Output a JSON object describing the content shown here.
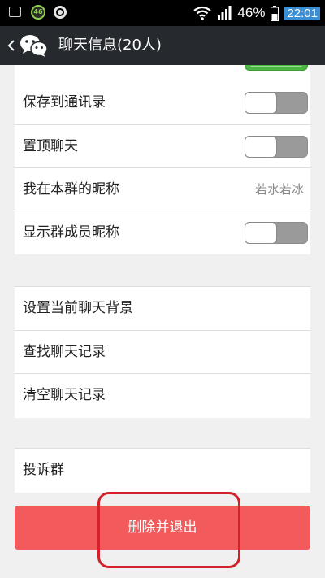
{
  "status_bar": {
    "badge_text": "46",
    "battery_text": "46%",
    "time": "22:01",
    "icons": [
      "gallery-icon",
      "app-badge-icon",
      "sync-ring-icon",
      "wifi-icon",
      "signal-icon",
      "battery-icon"
    ]
  },
  "header": {
    "title": "聊天信息(20人)",
    "icons": [
      "back-icon",
      "wechat-logo-icon"
    ]
  },
  "settings": {
    "group1": {
      "items": [
        {
          "label": "保存到通讯录",
          "control": "toggle",
          "on": false
        },
        {
          "label": "置顶聊天",
          "control": "toggle",
          "on": false
        },
        {
          "label": "我在本群的昵称",
          "value": "若水若冰"
        },
        {
          "label": "显示群成员昵称",
          "control": "toggle",
          "on": false
        }
      ]
    },
    "group2": {
      "items": [
        {
          "label": "设置当前聊天背景"
        },
        {
          "label": "查找聊天记录"
        },
        {
          "label": "清空聊天记录"
        }
      ]
    },
    "group3": {
      "items": [
        {
          "label": "投诉群"
        }
      ]
    }
  },
  "actions": {
    "delete_exit_label": "删除并退出"
  },
  "colors": {
    "status_bar_bg": "#000000",
    "title_bar_bg": "#262a2e",
    "page_bg": "#f0f0f0",
    "toggle_on": "#4cb544",
    "toggle_off": "#9a9a9a",
    "delete_button": "#f25a5c",
    "highlight_annotation": "#d5202c",
    "clock_bg": "#3a8fd6"
  }
}
